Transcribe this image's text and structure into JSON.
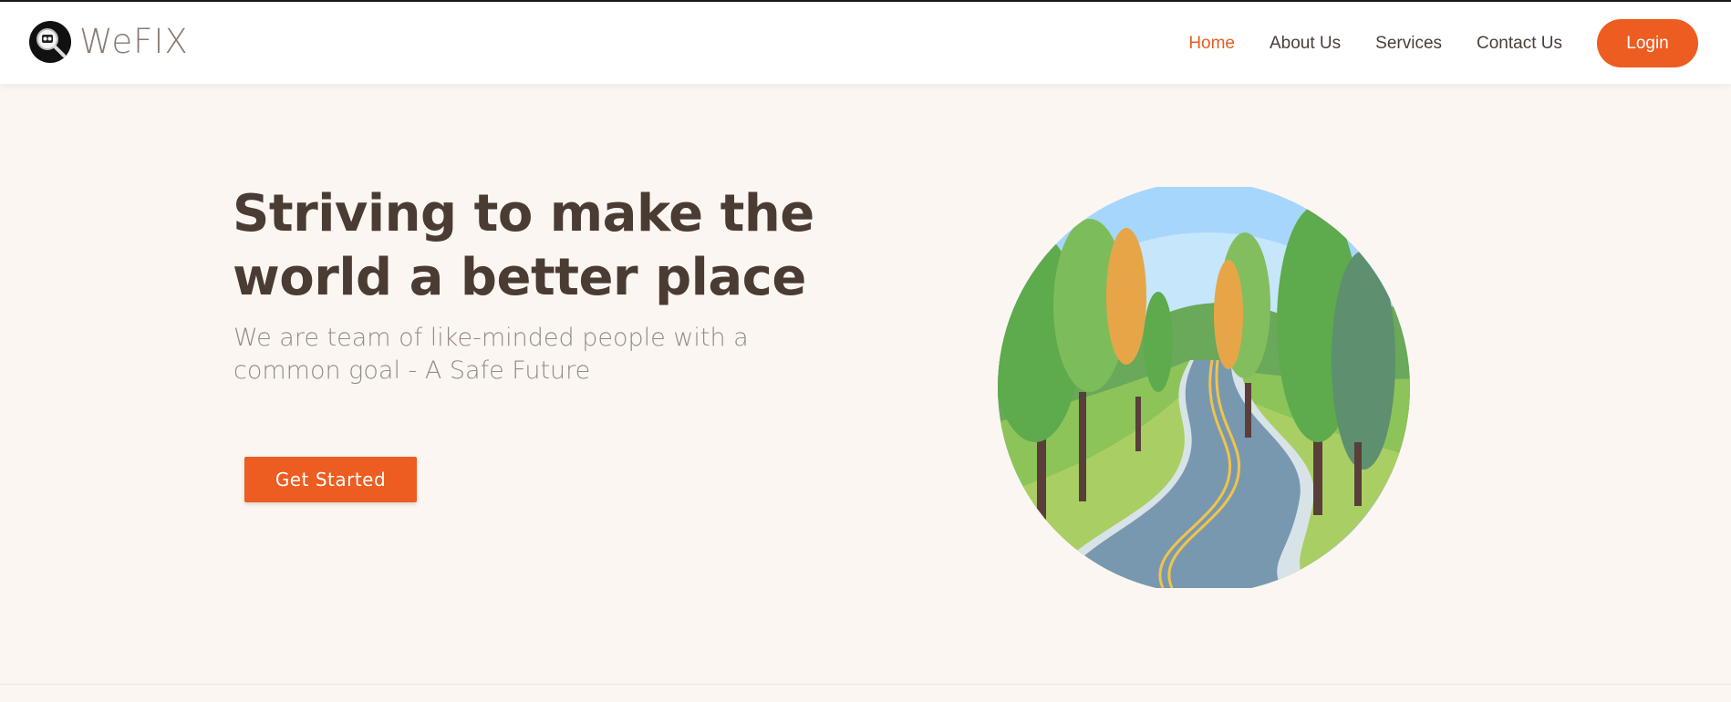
{
  "brand": {
    "name": "WeFIX",
    "logo_icon": "magnifier-logo-icon"
  },
  "nav": {
    "links": [
      {
        "label": "Home",
        "active": true
      },
      {
        "label": "About Us",
        "active": false
      },
      {
        "label": "Services",
        "active": false
      },
      {
        "label": "Contact Us",
        "active": false
      }
    ],
    "login_label": "Login"
  },
  "hero": {
    "title_line1": "Striving to make the",
    "title_line2": "world a better place",
    "subtitle_line1": "We are team of like-minded people with a",
    "subtitle_line2": "common goal - A Safe Future",
    "cta_label": "Get Started",
    "illustration": "winding-road-trees-illustration"
  },
  "colors": {
    "accent": "#ed5c20",
    "heading": "#4a3b33",
    "subtext": "#968a84",
    "background": "#fcf6f2"
  }
}
